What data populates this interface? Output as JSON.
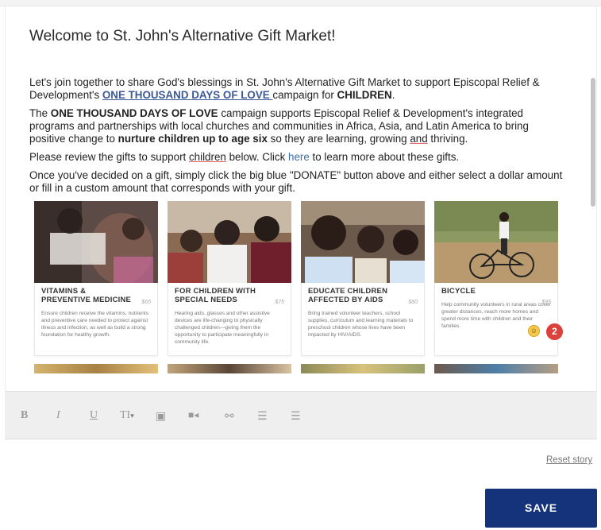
{
  "header": {
    "title": "Welcome to St. John's Alternative Gift Market!"
  },
  "story": {
    "p1_a": "Let's join together to share God's blessings in St. John's Alternative Gift Market to support Episcopal Relief & Development's ",
    "p1_link": "ONE THOUSAND DAYS OF LOVE ",
    "p1_b": "campaign for ",
    "p1_bold": "CHILDREN",
    "p1_c": ".",
    "p2_a": "The ",
    "p2_bold1": "ONE THOUSAND DAYS OF LOVE",
    "p2_b": " campaign supports Episcopal Relief & Development's integrated programs and partnerships with local churches and communities in Africa, Asia, and Latin America to bring positive change to ",
    "p2_bold2": "nurture children up to age six",
    "p2_c": " so they are learning, growing ",
    "p2_spell": "and",
    "p2_d": " thriving.",
    "p3_a": "Please review the gifts to support ",
    "p3_spell": "children",
    "p3_b": " below. Click ",
    "p3_link": "here",
    "p3_c": " to learn more about these gifts.",
    "p4": "Once you've decided on a gift, simply click the big blue \"DONATE\" button above and either select a dollar amount or fill in a custom amount that corresponds with your gift."
  },
  "gifts": [
    {
      "name": "VITAMINS & PREVENTIVE MEDICINE",
      "price": "$65",
      "description": "Ensure children receive the vitamins, nutrients and preventive care needed to protect against illness and infection, as well as build a strong foundation for healthy growth."
    },
    {
      "name": "FOR CHILDREN WITH SPECIAL NEEDS",
      "price": "$75",
      "description": "Hearing aids, glasses and other assistive devices are life-changing to physically challenged children—giving them the opportunity to participate meaningfully in community life."
    },
    {
      "name": "EDUCATE CHILDREN AFFECTED BY AIDS",
      "price": "$80",
      "description": "Bring trained volunteer teachers, school supplies, curriculum and learning materials to preschool children whose lives have been impacted by HIV/AIDS."
    },
    {
      "name": "BICYCLE",
      "price": "$95",
      "description": "Help community volunteers in rural areas cover greater distances, reach more homes and spend more time with children and their families."
    }
  ],
  "notification": {
    "count": "2"
  },
  "toolbar": {
    "bold": "B",
    "italic": "I",
    "underline": "U",
    "text_size": "TI",
    "text_size_caret": "▾",
    "image": "▣",
    "video": "■◂",
    "link": "⚯",
    "ordered_list": "☰",
    "unordered_list": "☰"
  },
  "footer": {
    "reset_label": "Reset story",
    "save_label": "SAVE"
  },
  "colors": {
    "save_button": "#14337a",
    "link": "#3b5998",
    "badge": "#dd3f3a"
  }
}
